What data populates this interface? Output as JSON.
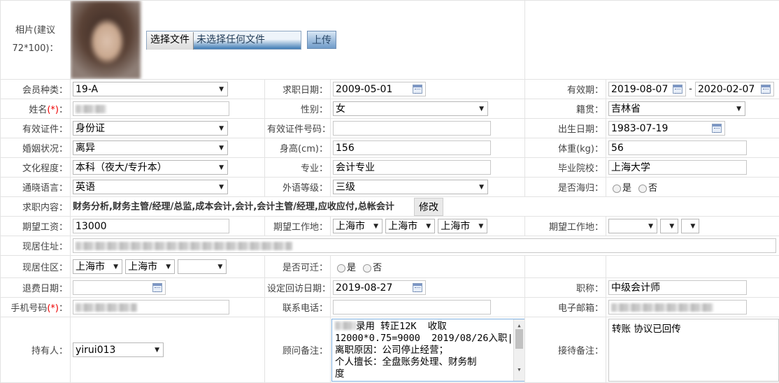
{
  "photo": {
    "label": "相片(建议72*100)：",
    "choose_file": "选择文件",
    "no_file": "未选择任何文件",
    "upload": "上传"
  },
  "member_type": {
    "label": "会员种类：",
    "value": "19-A"
  },
  "apply_date": {
    "label": "求职日期：",
    "value": "2009-05-01"
  },
  "validity": {
    "label": "有效期：",
    "from": "2019-08-07",
    "sep": "-",
    "to": "2020-02-07"
  },
  "name": {
    "label": "姓名",
    "req": "(*)",
    "suffix": "："
  },
  "gender": {
    "label": "性别：",
    "value": "女"
  },
  "native_place": {
    "label": "籍贯：",
    "value": "吉林省"
  },
  "id_type": {
    "label": "有效证件：",
    "value": "身份证"
  },
  "id_number": {
    "label": "有效证件号码：",
    "value": ""
  },
  "birth_date": {
    "label": "出生日期：",
    "value": "1983-07-19"
  },
  "marital": {
    "label": "婚姻状况：",
    "value": "离异"
  },
  "height": {
    "label": "身高(cm)：",
    "value": "156"
  },
  "weight": {
    "label": "体重(kg)：",
    "value": "56"
  },
  "education": {
    "label": "文化程度：",
    "value": "本科（夜大/专升本）"
  },
  "major": {
    "label": "专业：",
    "value": "会计专业"
  },
  "school": {
    "label": "毕业院校：",
    "value": "上海大学"
  },
  "language": {
    "label": "通晓语言：",
    "value": "英语"
  },
  "foreign_level": {
    "label": "外语等级：",
    "value": "三级"
  },
  "returnee": {
    "label": "是否海归：",
    "yes": "是",
    "no": "否"
  },
  "job_content": {
    "label": "求职内容：",
    "value": "财务分析,财务主管/经理/总监,成本会计,会计,会计主管/经理,应收应付,总帐会计",
    "modify": "修改"
  },
  "expected_salary": {
    "label": "期望工资：",
    "value": "13000"
  },
  "expected_location": {
    "label": "期望工作地：",
    "v1": "上海市",
    "v2": "上海市",
    "v3": "上海市"
  },
  "expected_location2": {
    "label": "期望工作地：",
    "v1": "",
    "v2": "",
    "v3": ""
  },
  "address": {
    "label": "现居住址："
  },
  "residence": {
    "label": "现居住区：",
    "v1": "上海市",
    "v2": "上海市",
    "v3": ""
  },
  "relocate": {
    "label": "是否可迁：",
    "yes": "是",
    "no": "否"
  },
  "refund_date": {
    "label": "退费日期：",
    "value": ""
  },
  "revisit_date": {
    "label": "设定回访日期：",
    "value": "2019-08-27"
  },
  "title": {
    "label": "职称：",
    "value": "中级会计师"
  },
  "mobile": {
    "label": "手机号码",
    "req": "(*)",
    "suffix": "："
  },
  "phone": {
    "label": "联系电话：",
    "value": ""
  },
  "email": {
    "label": "电子邮箱："
  },
  "holder": {
    "label": "持有人：",
    "value": "yirui013"
  },
  "consultant_note": {
    "label": "顾问备注：",
    "text": "录用 转正12K  收取\n12000*0.75=9000  2019/08/26入职|\n离职原因：公司停止经营；\n个人擅长：全盘账务处理、财务制\n度"
  },
  "reception_note": {
    "label": "接待备注：",
    "text": "转账 协议已回传"
  }
}
